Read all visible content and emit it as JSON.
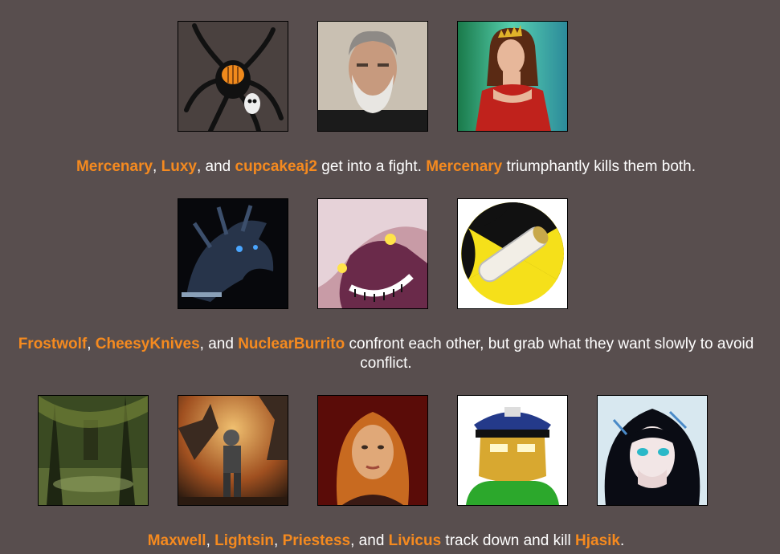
{
  "colors": {
    "background": "#584e4e",
    "name_highlight": "#f58a1f",
    "text": "#ffffff"
  },
  "events": [
    {
      "avatars": [
        {
          "name": "Mercenary",
          "icon": "spider-pumpkin-avatar-icon"
        },
        {
          "name": "Luxy",
          "icon": "bearded-man-avatar-icon"
        },
        {
          "name": "cupcakeaj2",
          "icon": "red-dress-queen-avatar-icon"
        }
      ],
      "caption": [
        {
          "t": "Mercenary",
          "name": true
        },
        {
          "t": ", ",
          "name": false
        },
        {
          "t": "Luxy",
          "name": true
        },
        {
          "t": ", and ",
          "name": false
        },
        {
          "t": "cupcakeaj2",
          "name": true
        },
        {
          "t": " get into a fight. ",
          "name": false
        },
        {
          "t": "Mercenary",
          "name": true
        },
        {
          "t": " triumphantly kills them both.",
          "name": false
        }
      ]
    },
    {
      "avatars": [
        {
          "name": "Frostwolf",
          "icon": "dark-dragon-avatar-icon"
        },
        {
          "name": "CheesyKnives",
          "icon": "grinning-creature-avatar-icon"
        },
        {
          "name": "NuclearBurrito",
          "icon": "radiation-burrito-avatar-icon"
        }
      ],
      "caption": [
        {
          "t": "Frostwolf",
          "name": true
        },
        {
          "t": ", ",
          "name": false
        },
        {
          "t": "CheesyKnives",
          "name": true
        },
        {
          "t": ", and ",
          "name": false
        },
        {
          "t": "NuclearBurrito",
          "name": true
        },
        {
          "t": " confront each other, but grab what they want slowly to avoid conflict.",
          "name": false
        }
      ]
    },
    {
      "avatars": [
        {
          "name": "Maxwell",
          "icon": "swamp-forest-avatar-icon"
        },
        {
          "name": "Lightsin",
          "icon": "armored-soldier-avatar-icon"
        },
        {
          "name": "Priestess",
          "icon": "red-haired-woman-avatar-icon"
        },
        {
          "name": "Livicus",
          "icon": "police-cap-cartoon-avatar-icon"
        },
        {
          "name": "Hjasik",
          "icon": "anime-girl-avatar-icon"
        }
      ],
      "caption": [
        {
          "t": "Maxwell",
          "name": true
        },
        {
          "t": ", ",
          "name": false
        },
        {
          "t": "Lightsin",
          "name": true
        },
        {
          "t": ", ",
          "name": false
        },
        {
          "t": "Priestess",
          "name": true
        },
        {
          "t": ", and ",
          "name": false
        },
        {
          "t": "Livicus",
          "name": true
        },
        {
          "t": " track down and kill ",
          "name": false
        },
        {
          "t": "Hjasik",
          "name": true
        },
        {
          "t": ".",
          "name": false
        }
      ]
    }
  ]
}
